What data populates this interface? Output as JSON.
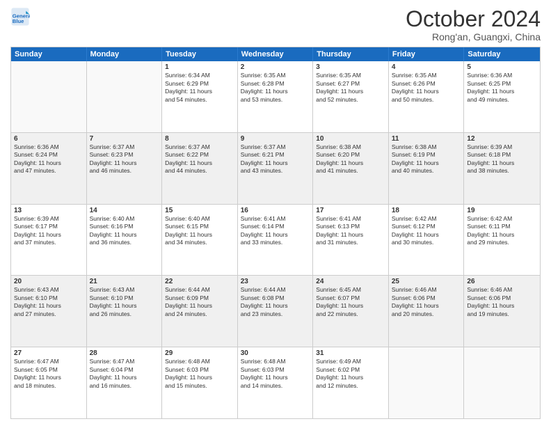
{
  "header": {
    "logo_general": "General",
    "logo_blue": "Blue",
    "month": "October 2024",
    "location": "Rong'an, Guangxi, China"
  },
  "days_of_week": [
    "Sunday",
    "Monday",
    "Tuesday",
    "Wednesday",
    "Thursday",
    "Friday",
    "Saturday"
  ],
  "weeks": [
    [
      {
        "day": "",
        "info": "",
        "shaded": false,
        "empty": true
      },
      {
        "day": "",
        "info": "",
        "shaded": false,
        "empty": true
      },
      {
        "day": "1",
        "info": "Sunrise: 6:34 AM\nSunset: 6:29 PM\nDaylight: 11 hours\nand 54 minutes.",
        "shaded": false,
        "empty": false
      },
      {
        "day": "2",
        "info": "Sunrise: 6:35 AM\nSunset: 6:28 PM\nDaylight: 11 hours\nand 53 minutes.",
        "shaded": false,
        "empty": false
      },
      {
        "day": "3",
        "info": "Sunrise: 6:35 AM\nSunset: 6:27 PM\nDaylight: 11 hours\nand 52 minutes.",
        "shaded": false,
        "empty": false
      },
      {
        "day": "4",
        "info": "Sunrise: 6:35 AM\nSunset: 6:26 PM\nDaylight: 11 hours\nand 50 minutes.",
        "shaded": false,
        "empty": false
      },
      {
        "day": "5",
        "info": "Sunrise: 6:36 AM\nSunset: 6:25 PM\nDaylight: 11 hours\nand 49 minutes.",
        "shaded": false,
        "empty": false
      }
    ],
    [
      {
        "day": "6",
        "info": "Sunrise: 6:36 AM\nSunset: 6:24 PM\nDaylight: 11 hours\nand 47 minutes.",
        "shaded": true,
        "empty": false
      },
      {
        "day": "7",
        "info": "Sunrise: 6:37 AM\nSunset: 6:23 PM\nDaylight: 11 hours\nand 46 minutes.",
        "shaded": true,
        "empty": false
      },
      {
        "day": "8",
        "info": "Sunrise: 6:37 AM\nSunset: 6:22 PM\nDaylight: 11 hours\nand 44 minutes.",
        "shaded": true,
        "empty": false
      },
      {
        "day": "9",
        "info": "Sunrise: 6:37 AM\nSunset: 6:21 PM\nDaylight: 11 hours\nand 43 minutes.",
        "shaded": true,
        "empty": false
      },
      {
        "day": "10",
        "info": "Sunrise: 6:38 AM\nSunset: 6:20 PM\nDaylight: 11 hours\nand 41 minutes.",
        "shaded": true,
        "empty": false
      },
      {
        "day": "11",
        "info": "Sunrise: 6:38 AM\nSunset: 6:19 PM\nDaylight: 11 hours\nand 40 minutes.",
        "shaded": true,
        "empty": false
      },
      {
        "day": "12",
        "info": "Sunrise: 6:39 AM\nSunset: 6:18 PM\nDaylight: 11 hours\nand 38 minutes.",
        "shaded": true,
        "empty": false
      }
    ],
    [
      {
        "day": "13",
        "info": "Sunrise: 6:39 AM\nSunset: 6:17 PM\nDaylight: 11 hours\nand 37 minutes.",
        "shaded": false,
        "empty": false
      },
      {
        "day": "14",
        "info": "Sunrise: 6:40 AM\nSunset: 6:16 PM\nDaylight: 11 hours\nand 36 minutes.",
        "shaded": false,
        "empty": false
      },
      {
        "day": "15",
        "info": "Sunrise: 6:40 AM\nSunset: 6:15 PM\nDaylight: 11 hours\nand 34 minutes.",
        "shaded": false,
        "empty": false
      },
      {
        "day": "16",
        "info": "Sunrise: 6:41 AM\nSunset: 6:14 PM\nDaylight: 11 hours\nand 33 minutes.",
        "shaded": false,
        "empty": false
      },
      {
        "day": "17",
        "info": "Sunrise: 6:41 AM\nSunset: 6:13 PM\nDaylight: 11 hours\nand 31 minutes.",
        "shaded": false,
        "empty": false
      },
      {
        "day": "18",
        "info": "Sunrise: 6:42 AM\nSunset: 6:12 PM\nDaylight: 11 hours\nand 30 minutes.",
        "shaded": false,
        "empty": false
      },
      {
        "day": "19",
        "info": "Sunrise: 6:42 AM\nSunset: 6:11 PM\nDaylight: 11 hours\nand 29 minutes.",
        "shaded": false,
        "empty": false
      }
    ],
    [
      {
        "day": "20",
        "info": "Sunrise: 6:43 AM\nSunset: 6:10 PM\nDaylight: 11 hours\nand 27 minutes.",
        "shaded": true,
        "empty": false
      },
      {
        "day": "21",
        "info": "Sunrise: 6:43 AM\nSunset: 6:10 PM\nDaylight: 11 hours\nand 26 minutes.",
        "shaded": true,
        "empty": false
      },
      {
        "day": "22",
        "info": "Sunrise: 6:44 AM\nSunset: 6:09 PM\nDaylight: 11 hours\nand 24 minutes.",
        "shaded": true,
        "empty": false
      },
      {
        "day": "23",
        "info": "Sunrise: 6:44 AM\nSunset: 6:08 PM\nDaylight: 11 hours\nand 23 minutes.",
        "shaded": true,
        "empty": false
      },
      {
        "day": "24",
        "info": "Sunrise: 6:45 AM\nSunset: 6:07 PM\nDaylight: 11 hours\nand 22 minutes.",
        "shaded": true,
        "empty": false
      },
      {
        "day": "25",
        "info": "Sunrise: 6:46 AM\nSunset: 6:06 PM\nDaylight: 11 hours\nand 20 minutes.",
        "shaded": true,
        "empty": false
      },
      {
        "day": "26",
        "info": "Sunrise: 6:46 AM\nSunset: 6:06 PM\nDaylight: 11 hours\nand 19 minutes.",
        "shaded": true,
        "empty": false
      }
    ],
    [
      {
        "day": "27",
        "info": "Sunrise: 6:47 AM\nSunset: 6:05 PM\nDaylight: 11 hours\nand 18 minutes.",
        "shaded": false,
        "empty": false
      },
      {
        "day": "28",
        "info": "Sunrise: 6:47 AM\nSunset: 6:04 PM\nDaylight: 11 hours\nand 16 minutes.",
        "shaded": false,
        "empty": false
      },
      {
        "day": "29",
        "info": "Sunrise: 6:48 AM\nSunset: 6:03 PM\nDaylight: 11 hours\nand 15 minutes.",
        "shaded": false,
        "empty": false
      },
      {
        "day": "30",
        "info": "Sunrise: 6:48 AM\nSunset: 6:03 PM\nDaylight: 11 hours\nand 14 minutes.",
        "shaded": false,
        "empty": false
      },
      {
        "day": "31",
        "info": "Sunrise: 6:49 AM\nSunset: 6:02 PM\nDaylight: 11 hours\nand 12 minutes.",
        "shaded": false,
        "empty": false
      },
      {
        "day": "",
        "info": "",
        "shaded": false,
        "empty": true
      },
      {
        "day": "",
        "info": "",
        "shaded": false,
        "empty": true
      }
    ]
  ]
}
